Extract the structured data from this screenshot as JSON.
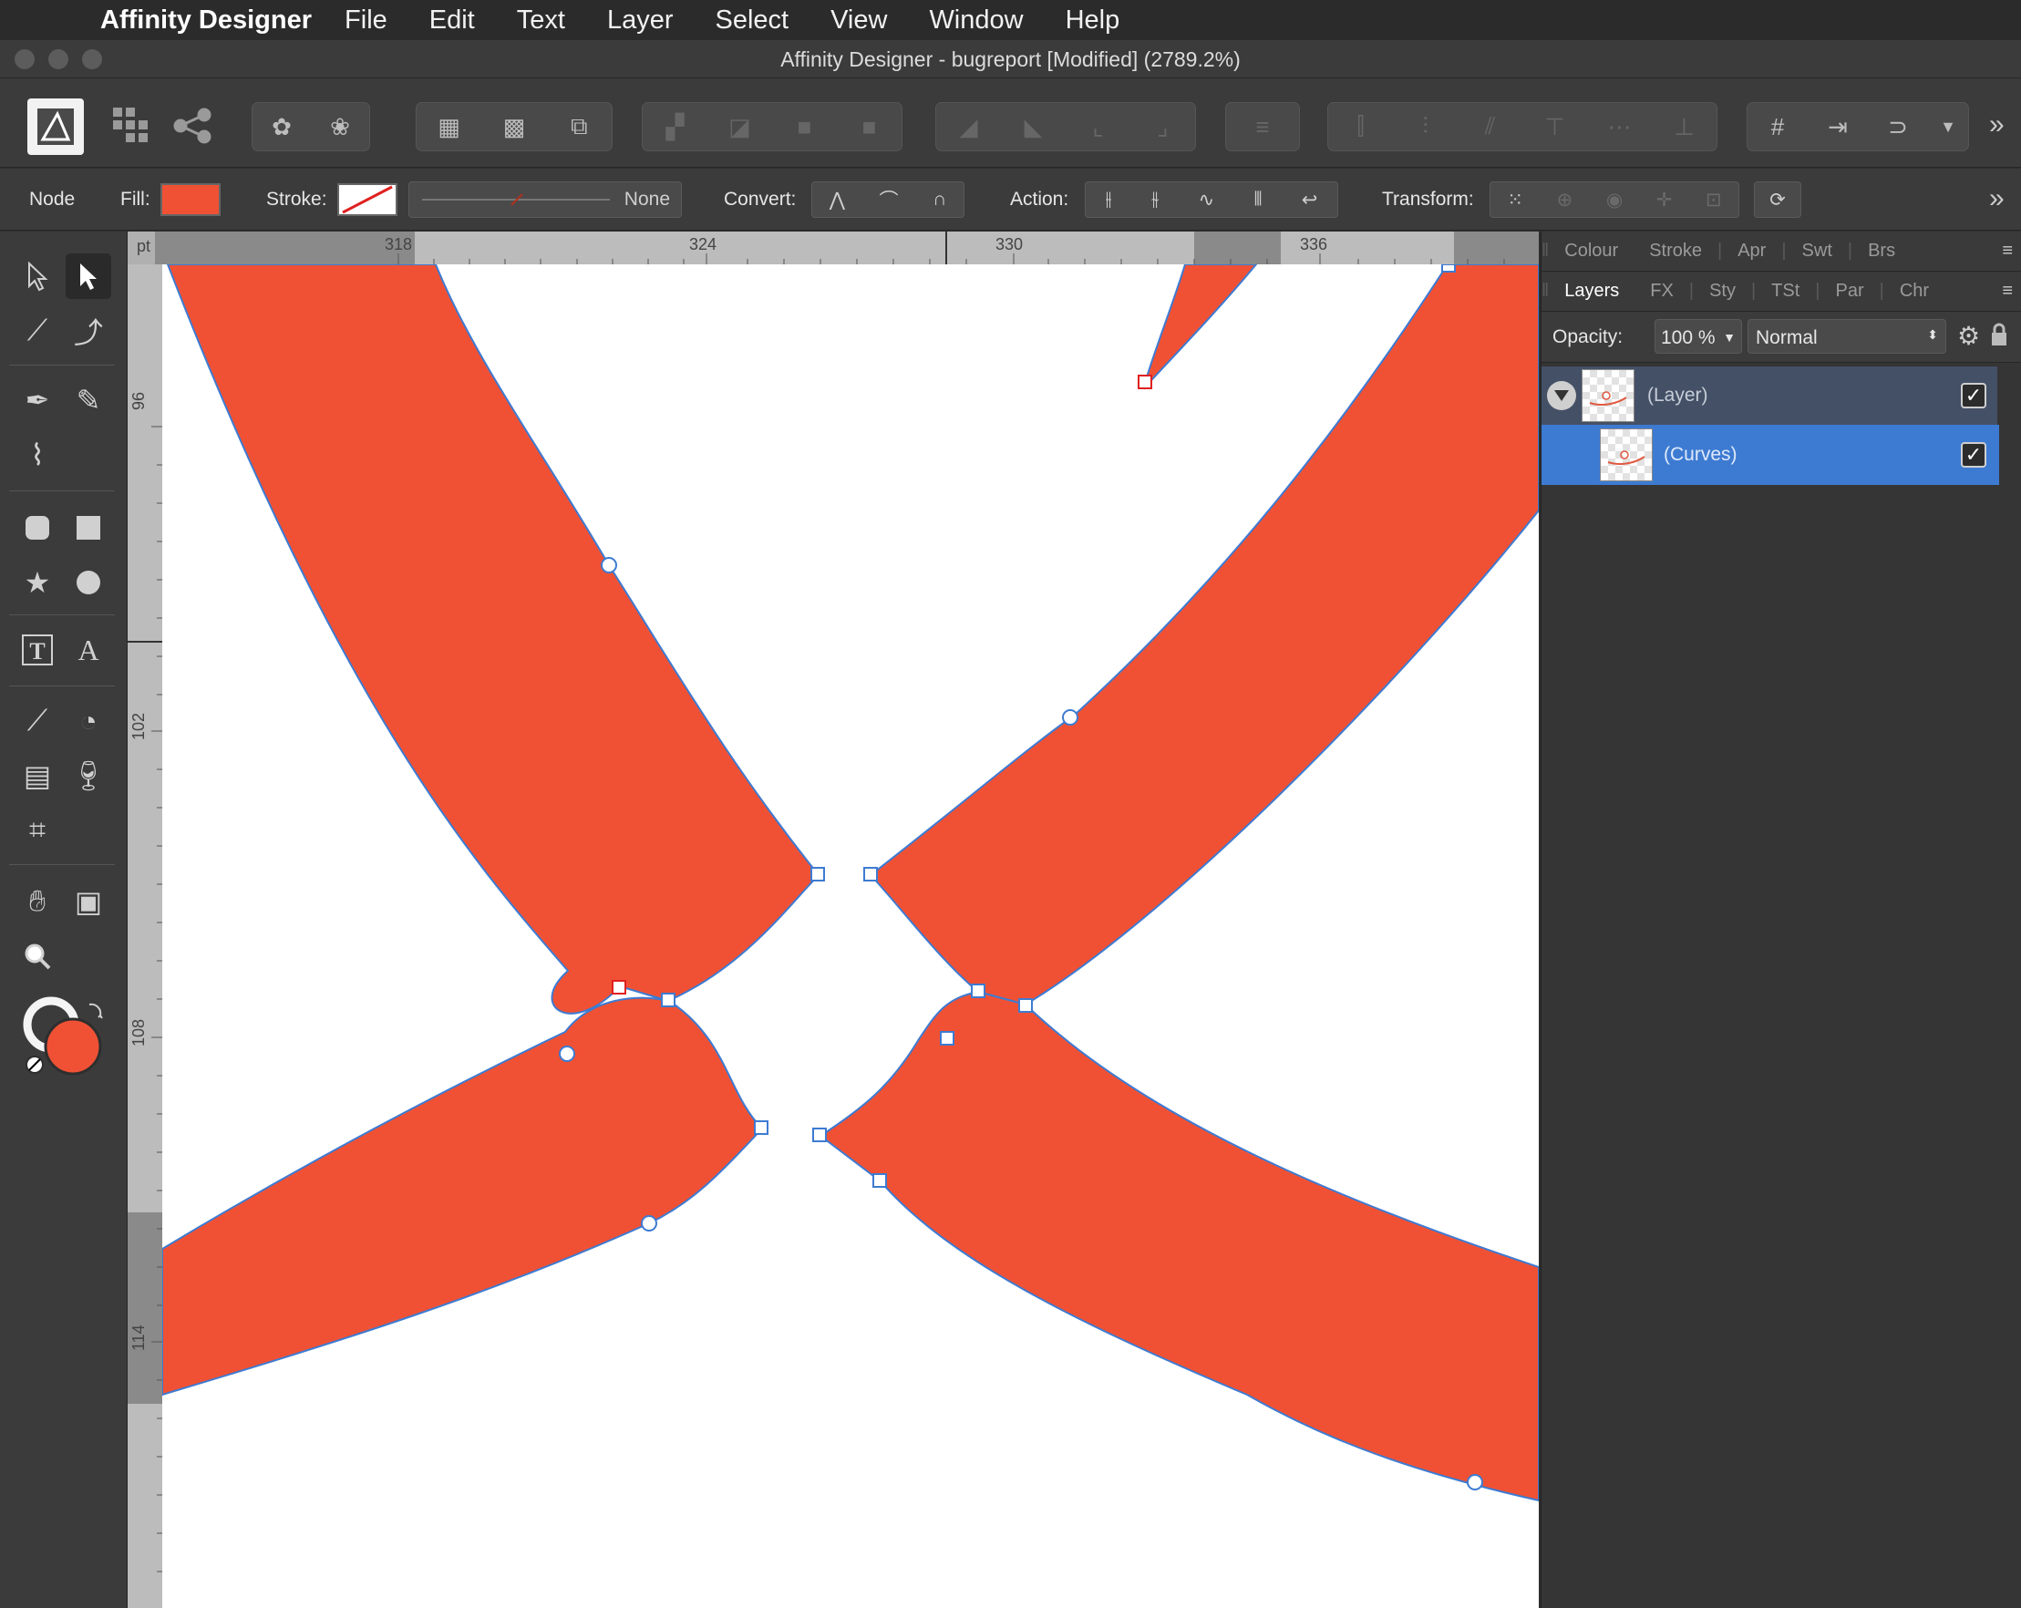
{
  "menubar": {
    "app_name": "Affinity Designer",
    "items": [
      "File",
      "Edit",
      "Text",
      "Layer",
      "Select",
      "View",
      "Window",
      "Help"
    ]
  },
  "window": {
    "title": "Affinity Designer - bugreport [Modified] (2789.2%)"
  },
  "context_toolbar": {
    "mode_label": "Node",
    "fill_label": "Fill:",
    "fill_color": "#f05134",
    "stroke_label": "Stroke:",
    "stroke_width_value": "None",
    "convert_label": "Convert:",
    "action_label": "Action:",
    "transform_label": "Transform:"
  },
  "rulers": {
    "unit": "pt",
    "horizontal_ticks": [
      "318",
      "324",
      "330",
      "336"
    ],
    "vertical_ticks": [
      "96",
      "102",
      "108",
      "114"
    ]
  },
  "right_panel": {
    "top_tabs": [
      "Colour",
      "Stroke",
      "Apr",
      "Swt",
      "Brs"
    ],
    "second_tabs": [
      "Layers",
      "FX",
      "Sty",
      "TSt",
      "Par",
      "Chr"
    ],
    "active_tab": "Layers",
    "opacity_label": "Opacity:",
    "opacity_value": "100 %",
    "blend_mode": "Normal",
    "layers": [
      {
        "name": "(Layer)",
        "visible": true,
        "expanded": true,
        "selected": false
      },
      {
        "name": "(Curves)",
        "visible": true,
        "selected": true
      }
    ]
  },
  "colors": {
    "accent_selection": "#3d7bd2",
    "shape_fill": "#f05134",
    "outline": "#3d7bd2",
    "selected_node": "#e02020"
  },
  "tools_panel": {
    "primary_color": "#f05134"
  }
}
